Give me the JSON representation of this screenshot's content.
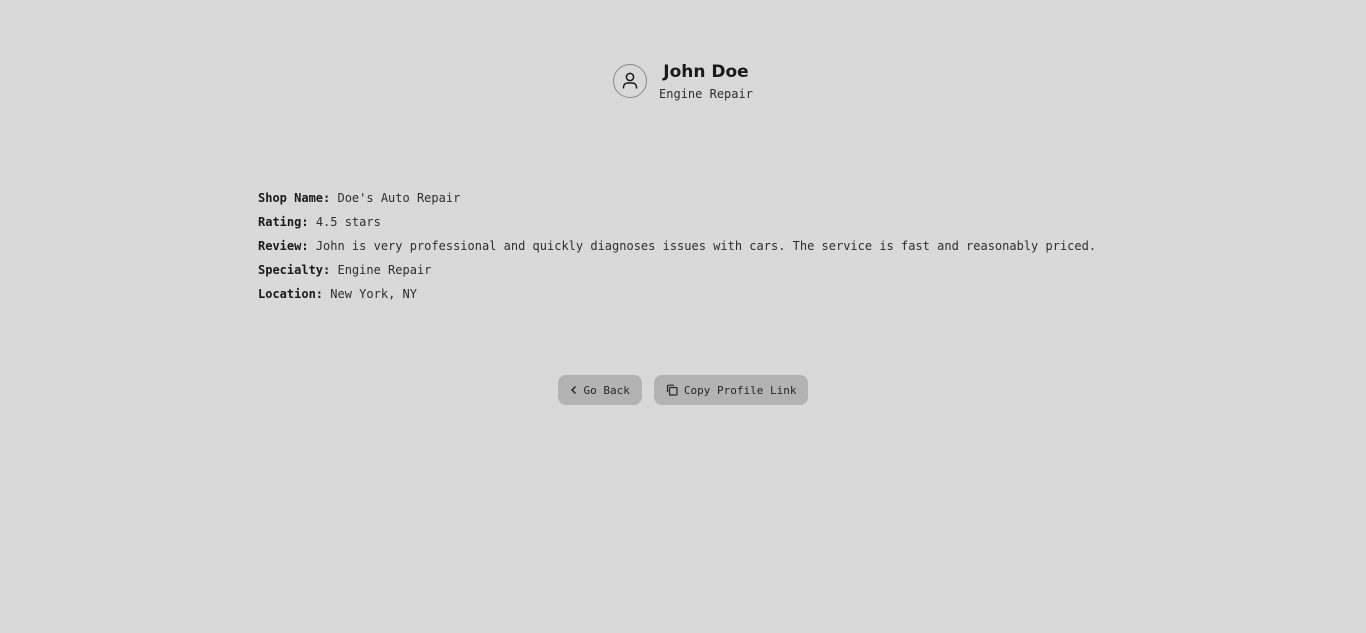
{
  "profile": {
    "name": "John Doe",
    "specialty": "Engine Repair",
    "avatar_icon": "user-icon"
  },
  "details": [
    {
      "label": "Shop Name:",
      "value": "Doe's Auto Repair"
    },
    {
      "label": "Rating:",
      "value": "4.5 stars"
    },
    {
      "label": "Review:",
      "value": "John is very professional and quickly diagnoses issues with cars. The service is fast and reasonably priced."
    },
    {
      "label": "Specialty:",
      "value": "Engine Repair"
    },
    {
      "label": "Location:",
      "value": "New York, NY"
    }
  ],
  "actions": {
    "back_label": "Go Back",
    "back_icon": "chevron-left-icon",
    "copy_label": "Copy Profile Link",
    "copy_icon": "copy-icon"
  },
  "colors": {
    "background": "#d9d9d9",
    "button": "#b3b3b3",
    "text": "#1c1c1c"
  }
}
